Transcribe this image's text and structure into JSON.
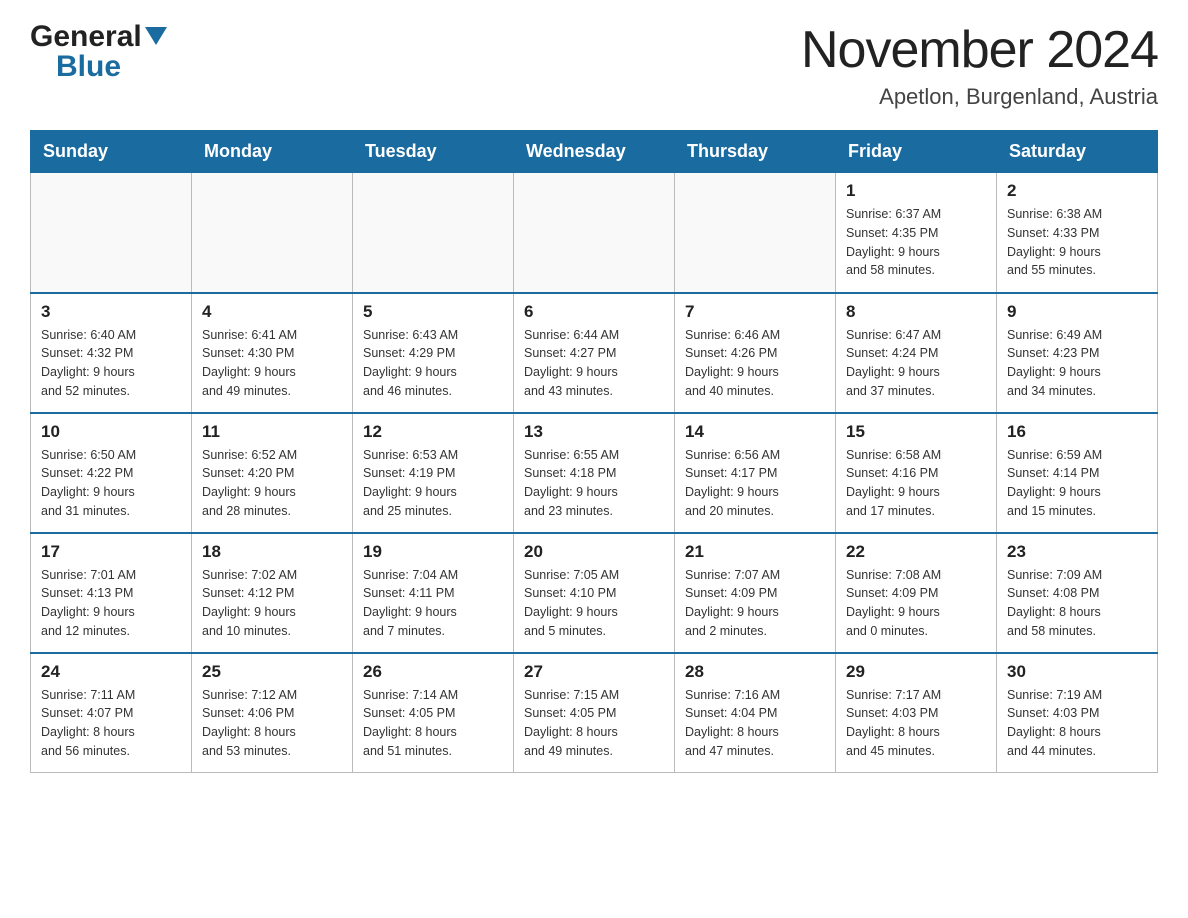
{
  "header": {
    "logo_general": "General",
    "logo_blue": "Blue",
    "title": "November 2024",
    "location": "Apetlon, Burgenland, Austria"
  },
  "weekdays": [
    "Sunday",
    "Monday",
    "Tuesday",
    "Wednesday",
    "Thursday",
    "Friday",
    "Saturday"
  ],
  "weeks": [
    [
      {
        "day": "",
        "info": ""
      },
      {
        "day": "",
        "info": ""
      },
      {
        "day": "",
        "info": ""
      },
      {
        "day": "",
        "info": ""
      },
      {
        "day": "",
        "info": ""
      },
      {
        "day": "1",
        "info": "Sunrise: 6:37 AM\nSunset: 4:35 PM\nDaylight: 9 hours\nand 58 minutes."
      },
      {
        "day": "2",
        "info": "Sunrise: 6:38 AM\nSunset: 4:33 PM\nDaylight: 9 hours\nand 55 minutes."
      }
    ],
    [
      {
        "day": "3",
        "info": "Sunrise: 6:40 AM\nSunset: 4:32 PM\nDaylight: 9 hours\nand 52 minutes."
      },
      {
        "day": "4",
        "info": "Sunrise: 6:41 AM\nSunset: 4:30 PM\nDaylight: 9 hours\nand 49 minutes."
      },
      {
        "day": "5",
        "info": "Sunrise: 6:43 AM\nSunset: 4:29 PM\nDaylight: 9 hours\nand 46 minutes."
      },
      {
        "day": "6",
        "info": "Sunrise: 6:44 AM\nSunset: 4:27 PM\nDaylight: 9 hours\nand 43 minutes."
      },
      {
        "day": "7",
        "info": "Sunrise: 6:46 AM\nSunset: 4:26 PM\nDaylight: 9 hours\nand 40 minutes."
      },
      {
        "day": "8",
        "info": "Sunrise: 6:47 AM\nSunset: 4:24 PM\nDaylight: 9 hours\nand 37 minutes."
      },
      {
        "day": "9",
        "info": "Sunrise: 6:49 AM\nSunset: 4:23 PM\nDaylight: 9 hours\nand 34 minutes."
      }
    ],
    [
      {
        "day": "10",
        "info": "Sunrise: 6:50 AM\nSunset: 4:22 PM\nDaylight: 9 hours\nand 31 minutes."
      },
      {
        "day": "11",
        "info": "Sunrise: 6:52 AM\nSunset: 4:20 PM\nDaylight: 9 hours\nand 28 minutes."
      },
      {
        "day": "12",
        "info": "Sunrise: 6:53 AM\nSunset: 4:19 PM\nDaylight: 9 hours\nand 25 minutes."
      },
      {
        "day": "13",
        "info": "Sunrise: 6:55 AM\nSunset: 4:18 PM\nDaylight: 9 hours\nand 23 minutes."
      },
      {
        "day": "14",
        "info": "Sunrise: 6:56 AM\nSunset: 4:17 PM\nDaylight: 9 hours\nand 20 minutes."
      },
      {
        "day": "15",
        "info": "Sunrise: 6:58 AM\nSunset: 4:16 PM\nDaylight: 9 hours\nand 17 minutes."
      },
      {
        "day": "16",
        "info": "Sunrise: 6:59 AM\nSunset: 4:14 PM\nDaylight: 9 hours\nand 15 minutes."
      }
    ],
    [
      {
        "day": "17",
        "info": "Sunrise: 7:01 AM\nSunset: 4:13 PM\nDaylight: 9 hours\nand 12 minutes."
      },
      {
        "day": "18",
        "info": "Sunrise: 7:02 AM\nSunset: 4:12 PM\nDaylight: 9 hours\nand 10 minutes."
      },
      {
        "day": "19",
        "info": "Sunrise: 7:04 AM\nSunset: 4:11 PM\nDaylight: 9 hours\nand 7 minutes."
      },
      {
        "day": "20",
        "info": "Sunrise: 7:05 AM\nSunset: 4:10 PM\nDaylight: 9 hours\nand 5 minutes."
      },
      {
        "day": "21",
        "info": "Sunrise: 7:07 AM\nSunset: 4:09 PM\nDaylight: 9 hours\nand 2 minutes."
      },
      {
        "day": "22",
        "info": "Sunrise: 7:08 AM\nSunset: 4:09 PM\nDaylight: 9 hours\nand 0 minutes."
      },
      {
        "day": "23",
        "info": "Sunrise: 7:09 AM\nSunset: 4:08 PM\nDaylight: 8 hours\nand 58 minutes."
      }
    ],
    [
      {
        "day": "24",
        "info": "Sunrise: 7:11 AM\nSunset: 4:07 PM\nDaylight: 8 hours\nand 56 minutes."
      },
      {
        "day": "25",
        "info": "Sunrise: 7:12 AM\nSunset: 4:06 PM\nDaylight: 8 hours\nand 53 minutes."
      },
      {
        "day": "26",
        "info": "Sunrise: 7:14 AM\nSunset: 4:05 PM\nDaylight: 8 hours\nand 51 minutes."
      },
      {
        "day": "27",
        "info": "Sunrise: 7:15 AM\nSunset: 4:05 PM\nDaylight: 8 hours\nand 49 minutes."
      },
      {
        "day": "28",
        "info": "Sunrise: 7:16 AM\nSunset: 4:04 PM\nDaylight: 8 hours\nand 47 minutes."
      },
      {
        "day": "29",
        "info": "Sunrise: 7:17 AM\nSunset: 4:03 PM\nDaylight: 8 hours\nand 45 minutes."
      },
      {
        "day": "30",
        "info": "Sunrise: 7:19 AM\nSunset: 4:03 PM\nDaylight: 8 hours\nand 44 minutes."
      }
    ]
  ]
}
